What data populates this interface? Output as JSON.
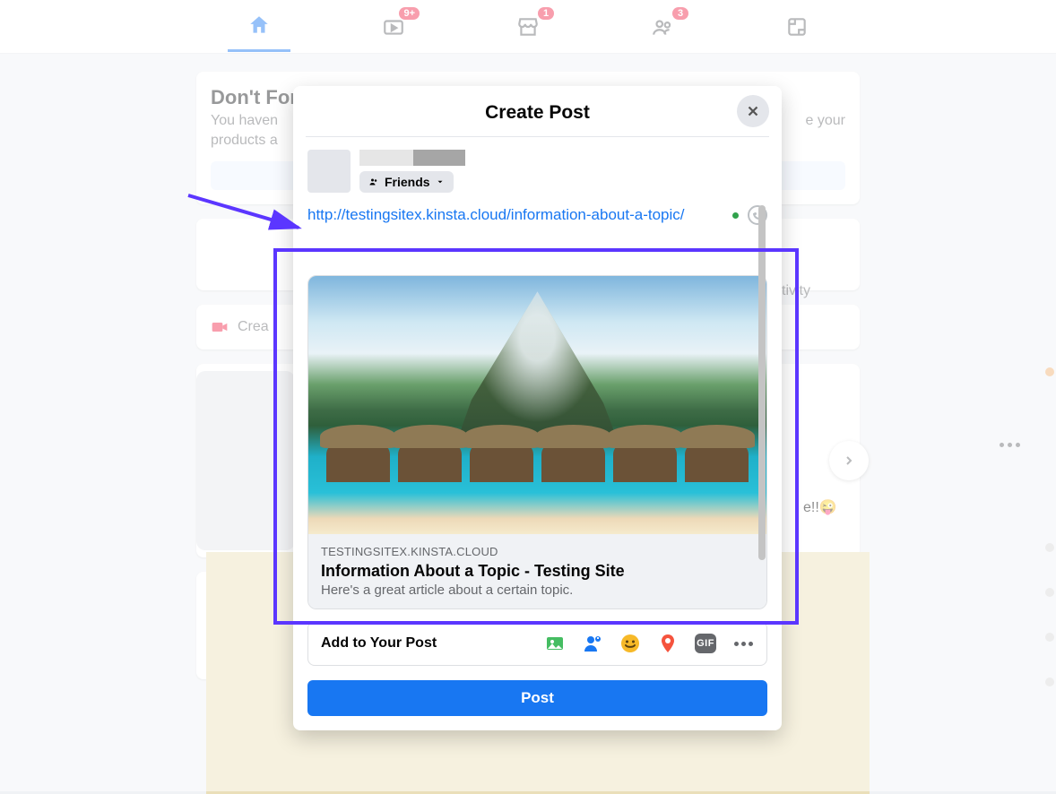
{
  "nav": {
    "home_badge": "",
    "watch_badge": "9+",
    "market_badge": "1",
    "groups_badge": "3",
    "gaming_badge": ""
  },
  "banner": {
    "title": "Don't Forget to Finish Upgrading Your Shop",
    "line1": "You haven",
    "line1_tail": "e your",
    "line2": "products a"
  },
  "story": {
    "next_label": "›"
  },
  "feed": {
    "cta_text": "Crea",
    "ivity_text": "tivity",
    "emoji_tail": "e!!😜"
  },
  "modal": {
    "title": "Create Post",
    "audience": "Friends",
    "compose_url": "http://testingsitex.kinsta.cloud/information-about-a-topic/",
    "preview": {
      "domain": "TESTINGSITEX.KINSTA.CLOUD",
      "title": "Information About a Topic - Testing Site",
      "description": "Here's a great article about a certain topic."
    },
    "add_to_post_label": "Add to Your Post",
    "gif_label": "GIF",
    "post_button": "Post"
  }
}
